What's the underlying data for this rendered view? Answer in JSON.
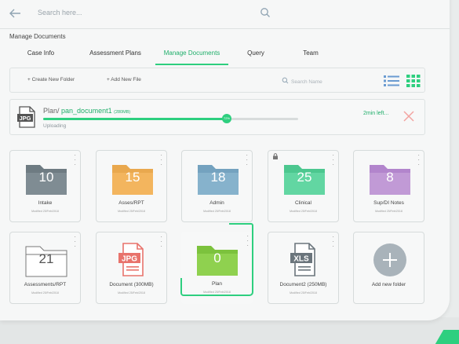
{
  "topbar": {
    "search_placeholder": "Search here..."
  },
  "page_title": "Manage Documents",
  "tabs": [
    {
      "label": "Case Info"
    },
    {
      "label": "Assessment Plans"
    },
    {
      "label": "Manage Documents",
      "active": true
    },
    {
      "label": "Query"
    },
    {
      "label": "Team"
    }
  ],
  "toolbar": {
    "create_folder": "+ Create New Folder",
    "add_file": "+ Add New File",
    "search_placeholder": "Search Name"
  },
  "upload": {
    "path_prefix": "Plan/",
    "file_name": "pan_document1",
    "file_size": "(280MB)",
    "status": "Uploading",
    "progress_percent": 72,
    "progress_label": "72%",
    "time_left": "2min left...",
    "file_type_label": "JPG"
  },
  "cards": [
    {
      "name": "Intake",
      "count": "10",
      "modified": "Modified 25/Feb/2018",
      "color": "#6e7b82"
    },
    {
      "name": "Asses/RPT",
      "count": "15",
      "modified": "Modified 25/Feb/2018",
      "color": "#f3b55e"
    },
    {
      "name": "Admin",
      "count": "18",
      "modified": "Modified 25/Feb/2018",
      "color": "#86b2cc"
    },
    {
      "name": "Clinical",
      "count": "25",
      "modified": "Modified 25/Feb/2018",
      "color": "#62d6a2",
      "locked": true
    },
    {
      "name": "Sup/DI Notes",
      "count": "8",
      "modified": "Modified 25/Feb/2018",
      "color": "#c19ad6"
    },
    {
      "name": "Assessments/RPT",
      "count": "21",
      "modified": "Modified 25/Feb/2018",
      "color": "#ffffff"
    },
    {
      "name": "Document (300MB)",
      "type_label": "JPG",
      "modified": "Modified 25/Feb/2018",
      "color": "#e8736c"
    },
    {
      "name": "Plan",
      "count": "0",
      "modified": "Modified 25/Feb/2018",
      "color": "#8fd14f",
      "selected": true
    },
    {
      "name": "Document2 (250MB)",
      "type_label": "XLS",
      "modified": "Modified 25/Feb/2018",
      "color": "#6b757c"
    },
    {
      "name": "Add new folder",
      "modified": "",
      "color": "#a9b3ba"
    }
  ],
  "colors": {
    "accent": "#2ecf7f",
    "text_accent": "#1fae6a"
  }
}
